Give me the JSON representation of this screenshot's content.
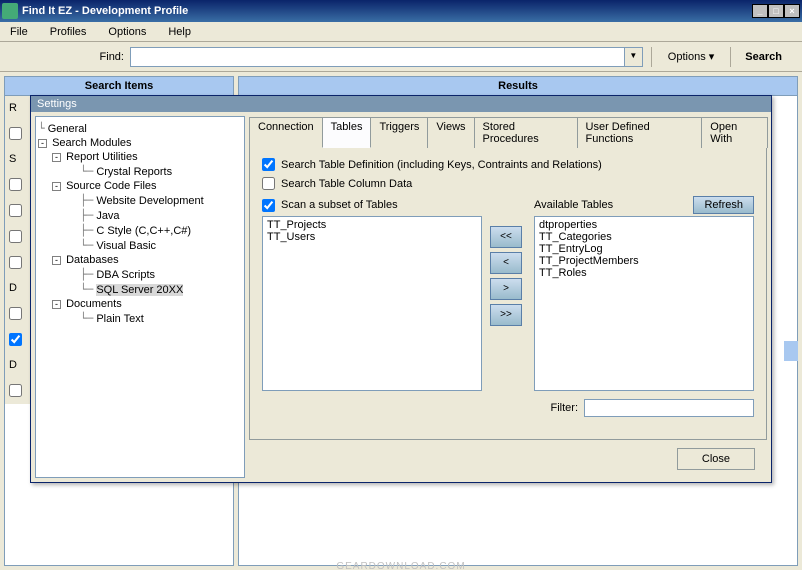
{
  "window": {
    "title": "Find It EZ - Development Profile"
  },
  "menu": {
    "file": "File",
    "profiles": "Profiles",
    "options": "Options",
    "help": "Help"
  },
  "findbar": {
    "label": "Find:",
    "value": "",
    "options": "Options",
    "search": "Search",
    "dropdown_arrow": "▼"
  },
  "panels": {
    "left": "Search Items",
    "right": "Results"
  },
  "sidebar_labels": {
    "r": "R",
    "s": "S",
    "d": "D",
    "d2": "D"
  },
  "settings": {
    "title": "Settings",
    "tree": {
      "general": "General",
      "search_modules": "Search Modules",
      "report_utilities": "Report Utilities",
      "crystal_reports": "Crystal Reports",
      "source_code_files": "Source Code Files",
      "website_dev": "Website Development",
      "java": "Java",
      "cstyle": "C Style (C,C++,C#)",
      "vb": "Visual Basic",
      "databases": "Databases",
      "dba_scripts": "DBA Scripts",
      "sql_server": "SQL Server 20XX",
      "documents": "Documents",
      "plain_text": "Plain Text"
    },
    "tabs": {
      "connection": "Connection",
      "tables": "Tables",
      "triggers": "Triggers",
      "views": "Views",
      "stored_procedures": "Stored Procedures",
      "udf": "User Defined Functions",
      "open_with": "Open With"
    },
    "checks": {
      "search_table_def": "Search Table Definition (including Keys, Contraints and Relations)",
      "search_col_data": "Search Table Column Data",
      "scan_subset": "Scan a subset of Tables"
    },
    "selected_tables": [
      "TT_Projects",
      "TT_Users"
    ],
    "available_label": "Available Tables",
    "refresh": "Refresh",
    "available_tables": [
      "dtproperties",
      "TT_Categories",
      "TT_EntryLog",
      "TT_ProjectMembers",
      "TT_Roles"
    ],
    "move": {
      "all_left": "<<",
      "left": "<",
      "right": ">",
      "all_right": ">>"
    },
    "filter_label": "Filter:",
    "filter_value": "",
    "close": "Close"
  },
  "watermark": "GEARDOWNLOAD.COM"
}
